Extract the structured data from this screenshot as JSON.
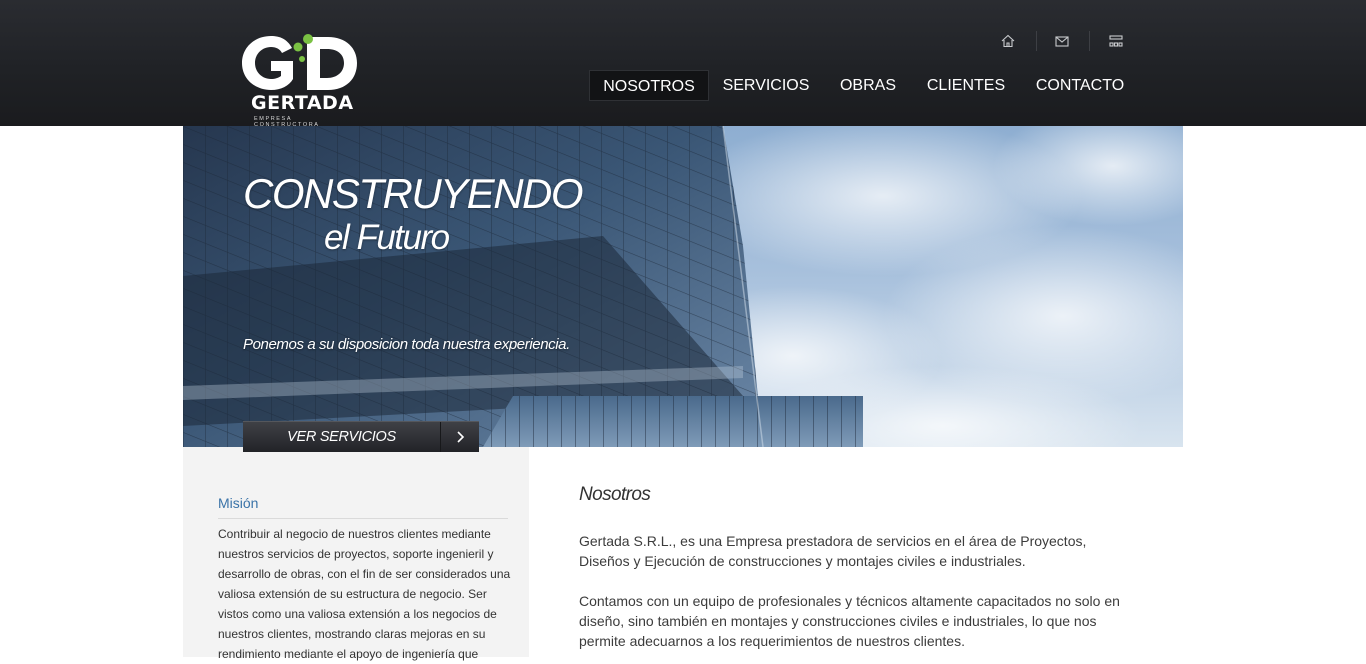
{
  "brand": {
    "logo_letters": "GD",
    "name": "GERTADA",
    "tagline": "EMPRESA CONSTRUCTORA",
    "accent": "#7ac143"
  },
  "utility_icons": [
    "home-icon",
    "mail-icon",
    "sitemap-icon"
  ],
  "nav": {
    "items": [
      {
        "label": "NOSOTROS",
        "active": true
      },
      {
        "label": "SERVICIOS",
        "active": false
      },
      {
        "label": "OBRAS",
        "active": false
      },
      {
        "label": "CLIENTES",
        "active": false
      },
      {
        "label": "CONTACTO",
        "active": false
      }
    ]
  },
  "hero": {
    "title_line1": "CONSTRUYENDO",
    "title_line2": "el Futuro",
    "tagline": "Ponemos a su disposicion toda nuestra experiencia.",
    "button_label": "VER SERVICIOS",
    "button_icon": "chevron-right-icon"
  },
  "sidebar": {
    "title": "Misión",
    "text": "Contribuir al negocio de nuestros clientes mediante nuestros servicios de proyectos, soporte ingenieril y desarrollo de obras, con el fin de ser considerados una valiosa extensión de su estructura de negocio. Ser vistos como una valiosa extensión a los negocios de nuestros clientes, mostrando claras mejoras en su rendimiento mediante el apoyo de ingeniería que"
  },
  "main": {
    "title": "Nosotros",
    "paragraph1": "Gertada S.R.L., es una Empresa prestadora de servicios en el área de Proyectos, Diseños y Ejecución de construcciones y montajes civiles e industriales.",
    "paragraph2": "Contamos con un equipo de profesionales y técnicos altamente capacitados no solo en diseño, sino también en montajes y construcciones civiles e industriales, lo que nos permite adecuarnos a los requerimientos de nuestros clientes."
  },
  "colors": {
    "header_bg": "#222428",
    "nav_active_bg": "#121315",
    "sidebar_bg": "#f3f3f3",
    "sidebar_title": "#3a73a8"
  }
}
